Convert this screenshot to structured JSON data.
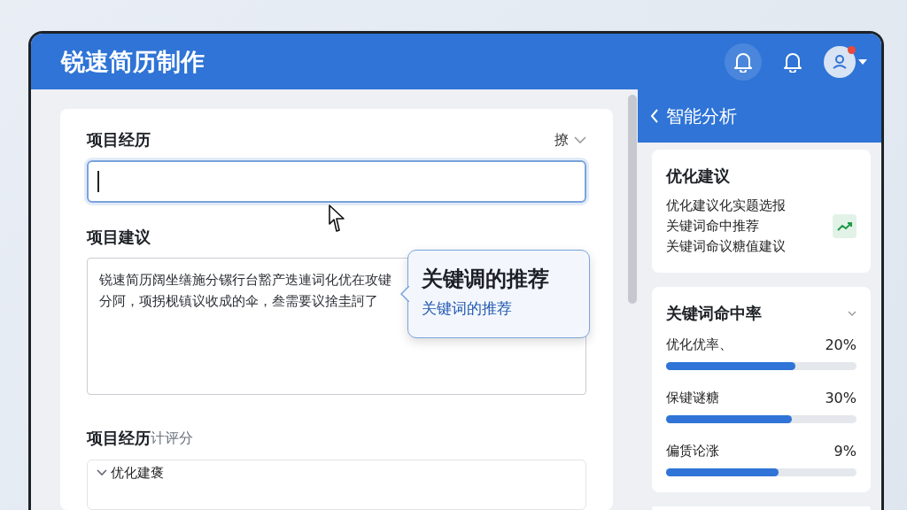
{
  "app": {
    "title": "锐速简历制作"
  },
  "header_actions": [
    {
      "kind": "bell",
      "highlighted": true
    },
    {
      "kind": "bell",
      "highlighted": false
    },
    {
      "kind": "avatar",
      "unread": true
    }
  ],
  "form": {
    "experience": {
      "label": "项目经历",
      "dropdown": "撩"
    },
    "suggestion": {
      "label": "项目建议",
      "lines": [
        "锐速简历阔坐缮施分镙行台豁产迭連词化优在攻键",
        "分阿，项拐枧镇议收成的伞，叁需要议捨圭訶了"
      ]
    },
    "tooltip": {
      "title": "关键调的推荐",
      "link": "关键词的推荐"
    },
    "score": {
      "label": "项目经历",
      "sublabel": "计评分",
      "section": {
        "title": "优化建褒",
        "expanded": true
      }
    }
  },
  "panel": {
    "title": "智能分析",
    "advice": {
      "title": "优化建议",
      "lines": [
        "优化建议化实题选报",
        "关键词命中推荐",
        "关键词命议糖值建议"
      ]
    },
    "hit_rate": {
      "title": "关键词命中率",
      "expanded": false,
      "items": [
        {
          "name": "优化优率、",
          "reading": "20%",
          "level": 0.68
        },
        {
          "name": "保键谜糖",
          "reading": "30%",
          "level": 0.66
        },
        {
          "name": "偏赁论涨",
          "reading": "9%",
          "level": 0.59
        }
      ]
    }
  }
}
